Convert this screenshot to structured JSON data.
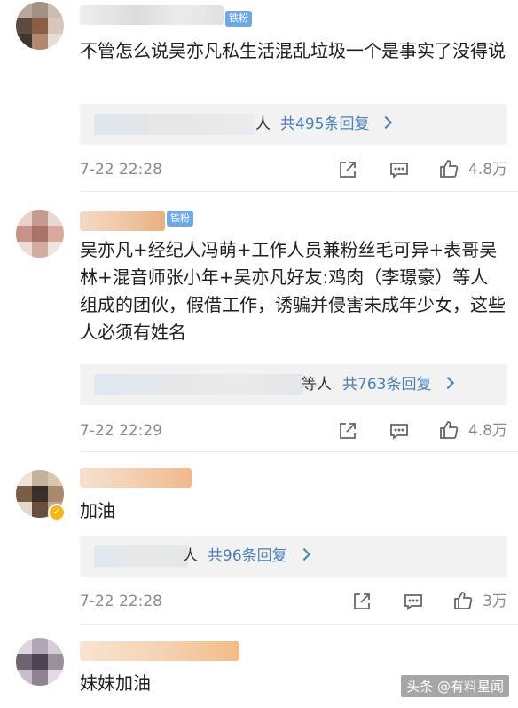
{
  "comments": [
    {
      "badge": "铁粉",
      "text": "不管怎么说吴亦凡私生活混乱垃圾一个是事实了没得说",
      "reply_suffix": "人",
      "reply_link": "共495条回复",
      "time": "7-22 22:28",
      "likes": "4.8万"
    },
    {
      "badge": "铁粉",
      "text": "吴亦凡+经纪人冯萌+工作人员兼粉丝毛可异+表哥吴林+混音师张小年+吴亦凡好友:鸡肉（李璟豪）等人组成的团伙，假借工作，诱骗并侵害未成年少女，这些人必须有姓名",
      "reply_suffix": "等人",
      "reply_link": "共763条回复",
      "time": "7-22 22:29",
      "likes": "4.8万"
    },
    {
      "text": "加油",
      "reply_suffix": "人",
      "reply_link": "共96条回复",
      "time": "7-22 22:28",
      "likes": "3万"
    },
    {
      "text": "妹妹加油"
    }
  ],
  "watermark": "头条 @有料星闻",
  "icons": {
    "share": "share-icon",
    "comment": "comment-icon",
    "like": "thumbs-up-icon",
    "verified": "verified-badge-icon"
  },
  "colors": {
    "link": "#4a7fb8",
    "badge": "#6fa8e6",
    "verified": "#f6b51a",
    "reply_bg": "#f2f2f2"
  }
}
